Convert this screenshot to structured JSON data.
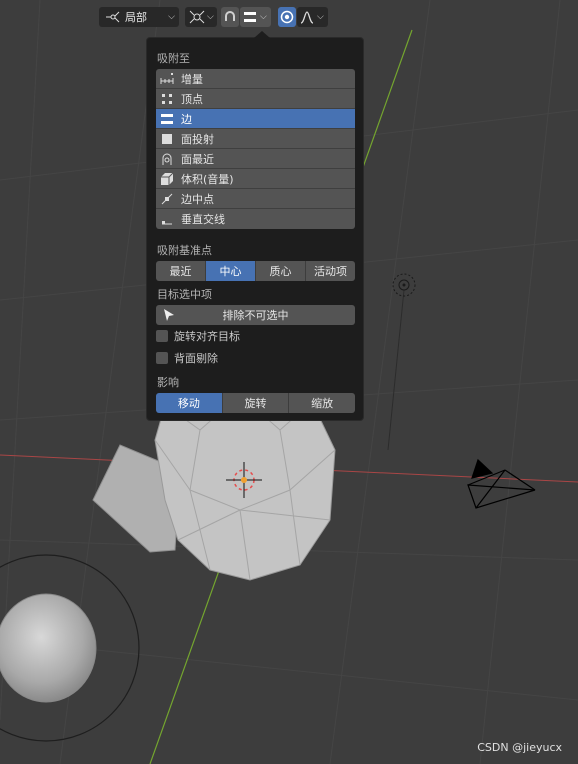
{
  "header": {
    "pivot_label": "局部"
  },
  "snap_popover": {
    "snap_to_heading": "吸附至",
    "snap_to_items": [
      {
        "label": "增量",
        "icon": "increment-icon",
        "selected": false
      },
      {
        "label": "顶点",
        "icon": "vertex-icon",
        "selected": false
      },
      {
        "label": "边",
        "icon": "edge-icon",
        "selected": true
      },
      {
        "label": "面投射",
        "icon": "face-project-icon",
        "selected": false
      },
      {
        "label": "面最近",
        "icon": "face-nearest-icon",
        "selected": false
      },
      {
        "label": "体积(音量)",
        "icon": "volume-icon",
        "selected": false
      },
      {
        "label": "边中点",
        "icon": "edge-midpoint-icon",
        "selected": false
      },
      {
        "label": "垂直交线",
        "icon": "perpendicular-icon",
        "selected": false
      }
    ],
    "snap_base_heading": "吸附基准点",
    "snap_base_options": [
      {
        "label": "最近",
        "active": false
      },
      {
        "label": "中心",
        "active": true
      },
      {
        "label": "质心",
        "active": false
      },
      {
        "label": "活动项",
        "active": false
      }
    ],
    "target_selection_heading": "目标选中项",
    "exclude_non_selectable_label": "排除不可选中",
    "align_rotation_label": "旋转对齐目标",
    "align_rotation_checked": false,
    "backface_culling_label": "背面剔除",
    "backface_culling_checked": false,
    "affect_heading": "影响",
    "affect_options": [
      {
        "label": "移动",
        "active": true
      },
      {
        "label": "旋转",
        "active": false
      },
      {
        "label": "缩放",
        "active": false
      }
    ]
  },
  "watermark": "CSDN @jieyucx",
  "colors": {
    "accent": "#4772b3",
    "panel_bg": "#1d1d1d",
    "item_bg": "#545454",
    "viewport_bg": "#3d3d3d",
    "x_axis": "#c04a4a",
    "y_axis": "#7fa33a"
  }
}
